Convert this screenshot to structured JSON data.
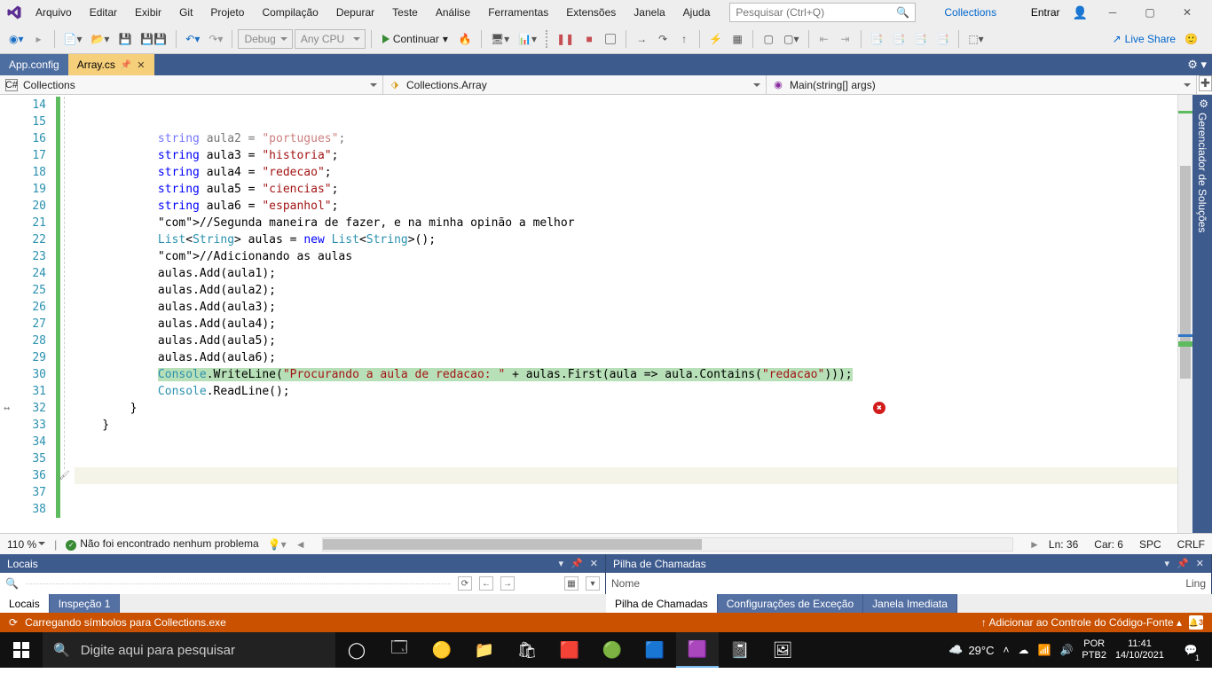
{
  "menu": {
    "items": [
      "Arquivo",
      "Editar",
      "Exibir",
      "Git",
      "Projeto",
      "Compilação",
      "Depurar",
      "Teste",
      "Análise",
      "Ferramentas",
      "Extensões",
      "Janela",
      "Ajuda"
    ]
  },
  "search": {
    "placeholder": "Pesquisar (Ctrl+Q)"
  },
  "solution_name": "Collections",
  "signin": "Entrar",
  "toolbar": {
    "config": "Debug",
    "platform": "Any CPU",
    "continue": "Continuar",
    "liveshare": "Live Share"
  },
  "tabs": [
    {
      "label": "App.config"
    },
    {
      "label": "Array.cs"
    }
  ],
  "nav": {
    "left": "Collections",
    "mid": "Collections.Array",
    "right": "Main(string[] args)"
  },
  "side_tool": "Gerenciador de Soluções",
  "code": {
    "first_line": 14,
    "lines": [
      {
        "n": 14,
        "t": "            string aula2 = \"portugues\";",
        "faded": true
      },
      {
        "n": 15,
        "t": "            string aula3 = \"historia\";"
      },
      {
        "n": 16,
        "t": "            string aula4 = \"redecao\";"
      },
      {
        "n": 17,
        "t": "            string aula5 = \"ciencias\";"
      },
      {
        "n": 18,
        "t": "            string aula6 = \"espanhol\";"
      },
      {
        "n": 19,
        "t": ""
      },
      {
        "n": 20,
        "t": "            //Segunda maneira de fazer, e na minha opinão a melhor"
      },
      {
        "n": 21,
        "t": "            List<String> aulas = new List<String>();"
      },
      {
        "n": 22,
        "t": ""
      },
      {
        "n": 23,
        "t": "            //Adicionando as aulas"
      },
      {
        "n": 24,
        "t": "            aulas.Add(aula1);"
      },
      {
        "n": 25,
        "t": "            aulas.Add(aula2);"
      },
      {
        "n": 26,
        "t": "            aulas.Add(aula3);"
      },
      {
        "n": 27,
        "t": "            aulas.Add(aula4);"
      },
      {
        "n": 28,
        "t": "            aulas.Add(aula5);"
      },
      {
        "n": 29,
        "t": "            aulas.Add(aula6);"
      },
      {
        "n": 30,
        "t": ""
      },
      {
        "n": 31,
        "t": ""
      },
      {
        "n": 32,
        "t": "            Console.WriteLine(\"Procurando a aula de redacao: \" + aulas.First(aula => aula.Contains(\"redacao\")));",
        "hl": true,
        "err": true
      },
      {
        "n": 33,
        "t": "            Console.ReadLine();"
      },
      {
        "n": 34,
        "t": "        }"
      },
      {
        "n": 35,
        "t": ""
      },
      {
        "n": 36,
        "t": "    }",
        "cur": true
      },
      {
        "n": 37,
        "t": ""
      },
      {
        "n": 38,
        "t": ""
      }
    ]
  },
  "editor_status": {
    "zoom": "110 %",
    "problems": "Não foi encontrado nenhum problema",
    "ln": "Ln: 36",
    "car": "Car: 6",
    "spc": "SPC",
    "crlf": "CRLF"
  },
  "panel_left": {
    "title": "Locais"
  },
  "panel_right": {
    "title": "Pilha de Chamadas",
    "col": "Nome",
    "lang": "Ling"
  },
  "panel_tabs_left": [
    {
      "label": "Locais",
      "active": true
    },
    {
      "label": "Inspeção 1",
      "active": false
    }
  ],
  "panel_tabs_right": [
    {
      "label": "Pilha de Chamadas",
      "active": true
    },
    {
      "label": "Configurações de Exceção",
      "active": false
    },
    {
      "label": "Janela Imediata",
      "active": false
    }
  ],
  "vs_status": {
    "msg": "Carregando símbolos para Collections.exe",
    "right": "Adicionar ao Controle do Código-Fonte",
    "badge": "3"
  },
  "taskbar": {
    "search": "Digite aqui para pesquisar",
    "weather": "29°C",
    "lang1": "POR",
    "lang2": "PTB2",
    "time": "11:41",
    "date": "14/10/2021",
    "notif": "1"
  }
}
